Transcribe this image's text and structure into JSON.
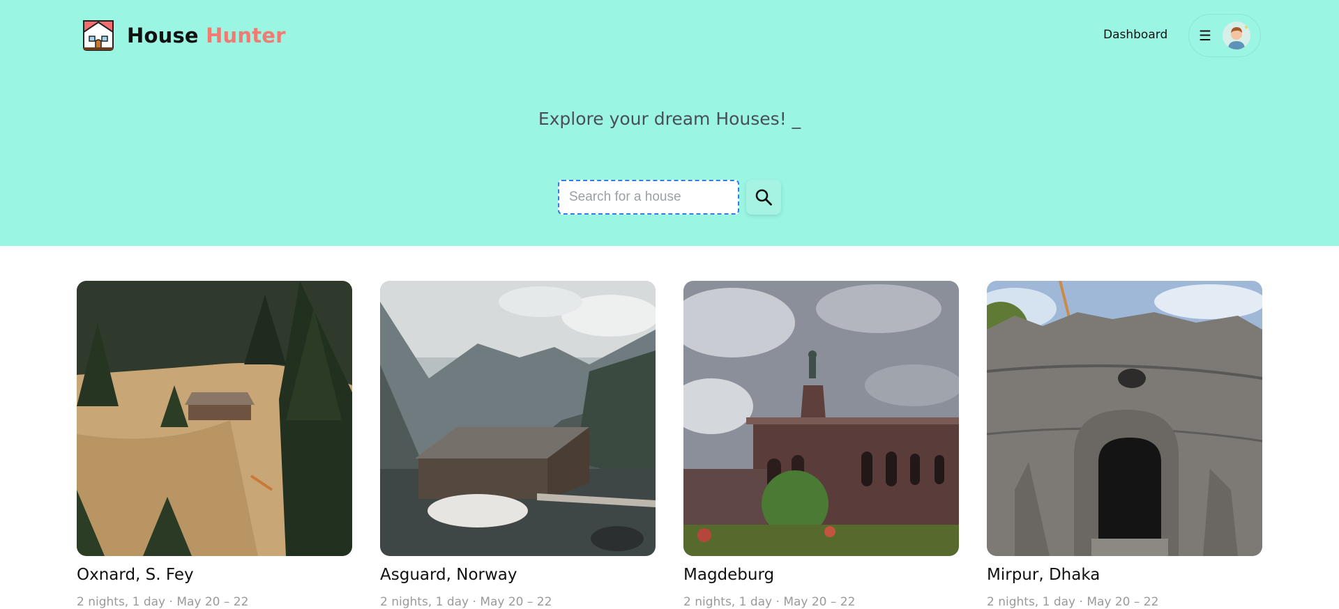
{
  "header": {
    "brand_main": "House",
    "brand_accent": "Hunter",
    "nav_dashboard": "Dashboard",
    "menu_icon": "hamburger-icon",
    "avatar_icon": "user-avatar"
  },
  "hero": {
    "tagline": "Explore your dream Houses! _",
    "search": {
      "placeholder": "Search for a house",
      "value": "",
      "button_icon": "search-icon"
    }
  },
  "colors": {
    "hero_bg": "#9af5e3",
    "brand_accent": "#f07b72",
    "search_border": "#2f7fe0"
  },
  "listings": [
    {
      "title": "Oxnard, S. Fey",
      "subtitle": "2 nights, 1 day · May 20 – 22",
      "image": "mountain-cabin-meadow"
    },
    {
      "title": "Asguard, Norway",
      "subtitle": "2 nights, 1 day · May 20 – 22",
      "image": "lake-boathouse-mountains"
    },
    {
      "title": "Magdeburg",
      "subtitle": "2 nights, 1 day · May 20 – 22",
      "image": "statue-monument-building"
    },
    {
      "title": "Mirpur, Dhaka",
      "subtitle": "2 nights, 1 day · May 20 – 22",
      "image": "stone-grotto-archway"
    }
  ]
}
